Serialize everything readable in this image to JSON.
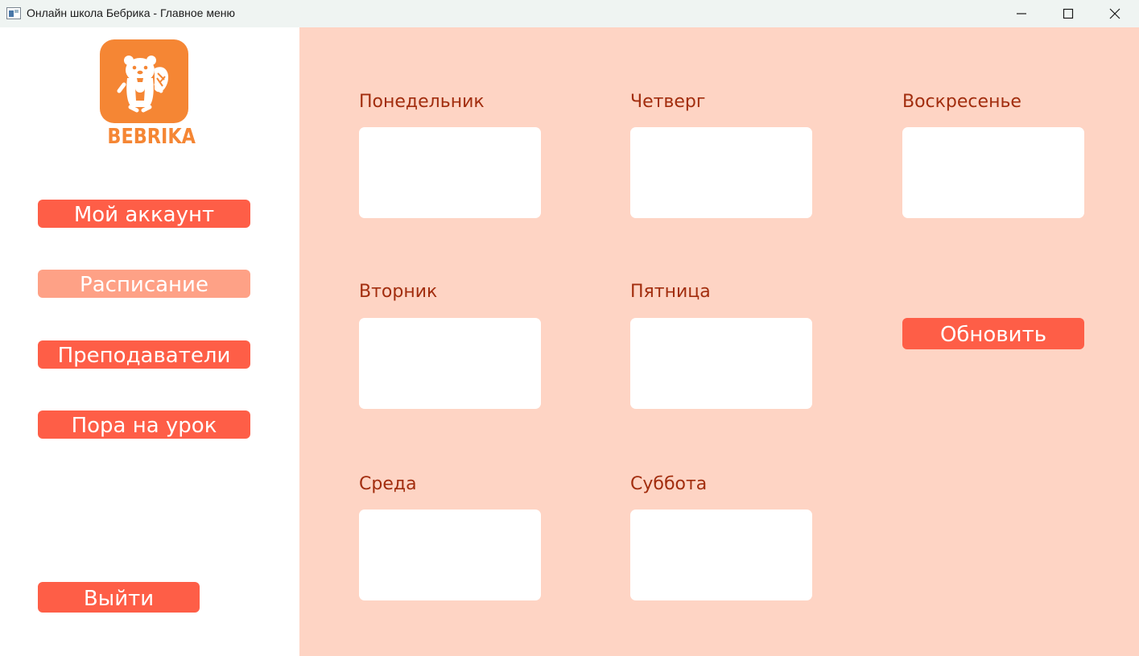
{
  "window": {
    "title": "Онлайн школа Бебрика - Главное меню"
  },
  "logo": {
    "text": "BEBRIKA",
    "icon": "beaver-logo-icon",
    "color": "#f58634"
  },
  "sidebar": {
    "items": [
      {
        "label": "Мой аккаунт",
        "active": false
      },
      {
        "label": "Расписание",
        "active": true
      },
      {
        "label": "Преподаватели",
        "active": false
      },
      {
        "label": "Пора на урок",
        "active": false
      }
    ],
    "exit_label": "Выйти"
  },
  "schedule": {
    "days": [
      {
        "label": "Понедельник",
        "content": ""
      },
      {
        "label": "Вторник",
        "content": ""
      },
      {
        "label": "Среда",
        "content": ""
      },
      {
        "label": "Четверг",
        "content": ""
      },
      {
        "label": "Пятница",
        "content": ""
      },
      {
        "label": "Суббота",
        "content": ""
      },
      {
        "label": "Воскресенье",
        "content": ""
      }
    ],
    "refresh_label": "Обновить"
  },
  "colors": {
    "accent": "#fe5e47",
    "active_nav": "#fea186",
    "main_background": "#fed4c4",
    "day_label": "#a22d0e"
  }
}
